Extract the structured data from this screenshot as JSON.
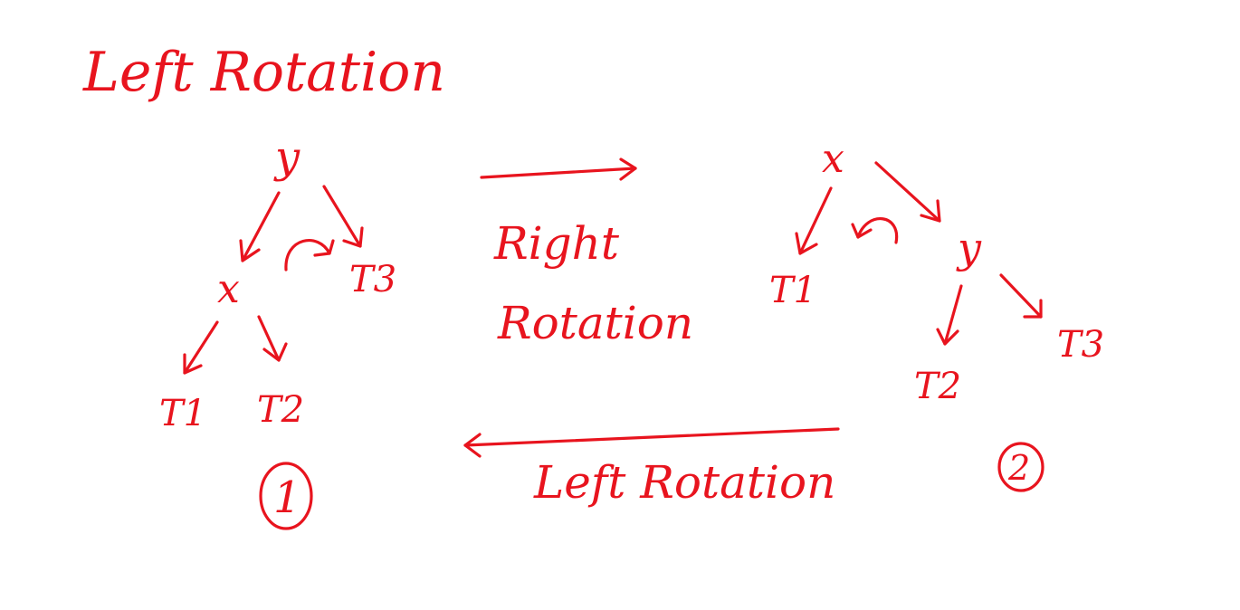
{
  "title": "Left Rotation",
  "ink_color": "#e8141e",
  "background_color": "#ffffff",
  "tree1": {
    "root": "y",
    "left_child": "x",
    "right_child": "T3",
    "x_left": "T1",
    "x_right": "T2",
    "badge": "1"
  },
  "tree2": {
    "root": "x",
    "left_child": "T1",
    "right_child": "y",
    "y_left": "T2",
    "y_right": "T3",
    "badge": "2"
  },
  "top_arrow_label": [
    "Right",
    "Rotation"
  ],
  "bottom_arrow_label": "Left Rotation"
}
